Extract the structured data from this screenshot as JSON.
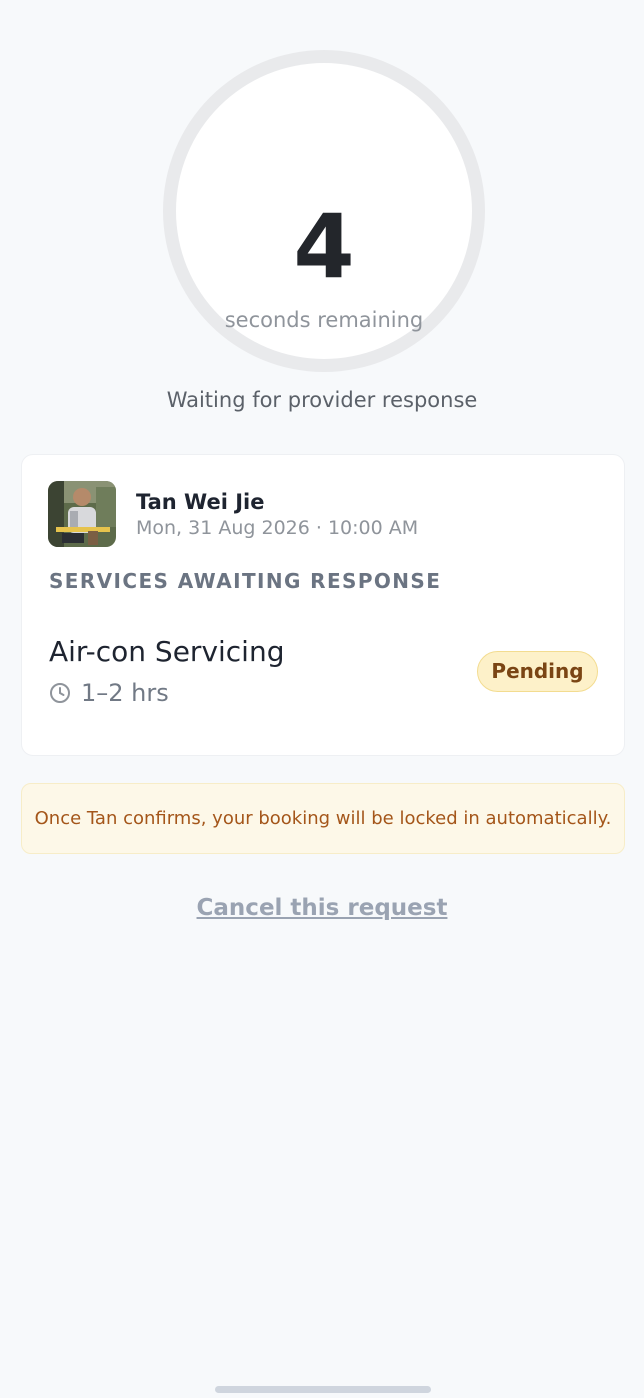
{
  "timer": {
    "count": "4",
    "caption": "seconds remaining"
  },
  "status_message": "Waiting for provider response",
  "booking": {
    "provider_name": "Tan Wei Jie",
    "date_time": "Mon, 31 Aug 2026 · 10:00 AM",
    "section_label": "SERVICES AWAITING RESPONSE",
    "service": {
      "name": "Air-con Servicing",
      "duration": "1–2 hrs",
      "duration_icon": "clock-icon",
      "status": "Pending"
    }
  },
  "notice": "Once Tan confirms, your booking will be locked in automatically.",
  "cancel_label": "Cancel this request",
  "colors": {
    "background": "#f7f9fb",
    "badge_bg": "#fdf1c9",
    "badge_text": "#7a4514",
    "notice_bg": "#fdf8e8",
    "notice_text": "#a4561a",
    "link": "#9aa3b2"
  }
}
